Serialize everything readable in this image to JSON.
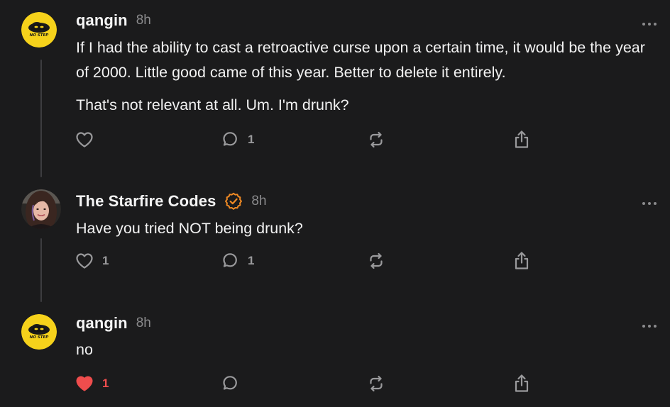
{
  "posts": [
    {
      "author": "qangin",
      "time": "8h",
      "verified": false,
      "avatar": "no-step-snake-avatar",
      "avatar_text": "NO STEP",
      "paragraphs": [
        "If I had the ability to cast a retroactive curse upon a certain time, it would be the year of 2000. Little good came of this year. Better to delete it entirely.",
        "That's not relevant at all. Um. I'm drunk?"
      ],
      "likes": "",
      "liked": false,
      "replies": "1",
      "reposts": "",
      "icons": [
        "heart-icon",
        "comment-icon",
        "repost-icon",
        "share-icon",
        "more-icon"
      ]
    },
    {
      "author": "The Starfire Codes",
      "time": "8h",
      "verified": true,
      "avatar": "profile-photo-avatar",
      "paragraphs": [
        "Have you tried NOT being drunk?"
      ],
      "likes": "1",
      "liked": false,
      "replies": "1",
      "reposts": "",
      "icons": [
        "heart-icon",
        "comment-icon",
        "repost-icon",
        "share-icon",
        "more-icon"
      ]
    },
    {
      "author": "qangin",
      "time": "8h",
      "verified": false,
      "avatar": "no-step-snake-avatar",
      "avatar_text": "NO STEP",
      "paragraphs": [
        "no"
      ],
      "likes": "1",
      "liked": true,
      "replies": "",
      "reposts": "",
      "icons": [
        "heart-filled-icon",
        "comment-icon",
        "repost-icon",
        "share-icon",
        "more-icon"
      ]
    }
  ],
  "colors": {
    "background": "#1b1b1c",
    "text": "#f2f2f2",
    "muted": "#8b8b8d",
    "icon": "#9a9a9c",
    "like_active": "#ef4d4d",
    "verified": "#f08a24",
    "thread_line": "#3d3d40",
    "avatar_yellow": "#f6d21b"
  }
}
